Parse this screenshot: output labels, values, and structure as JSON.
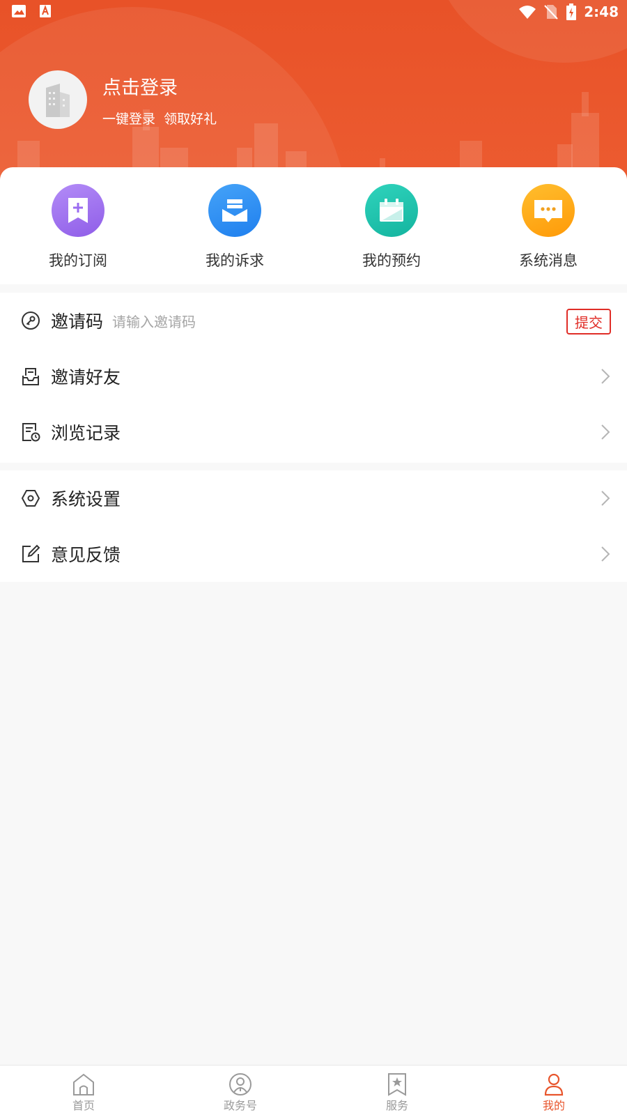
{
  "status_bar": {
    "time": "2:48"
  },
  "profile": {
    "login_title": "点击登录",
    "login_subtitle": "一键登录  领取好礼"
  },
  "quick_actions": [
    {
      "label": "我的订阅",
      "icon": "bookmark-add-icon",
      "color": "#9b6cf0"
    },
    {
      "label": "我的诉求",
      "icon": "mail-icon",
      "color": "#2b8cf4"
    },
    {
      "label": "我的预约",
      "icon": "calendar-icon",
      "color": "#1cc2ac"
    },
    {
      "label": "系统消息",
      "icon": "message-icon",
      "color": "#ffa510"
    }
  ],
  "invite_code": {
    "label": "邀请码",
    "placeholder": "请输入邀请码",
    "submit_label": "提交"
  },
  "menu_section_1": [
    {
      "label": "邀请好友",
      "icon": "inbox-icon"
    },
    {
      "label": "浏览记录",
      "icon": "history-icon"
    }
  ],
  "menu_section_2": [
    {
      "label": "系统设置",
      "icon": "settings-icon"
    },
    {
      "label": "意见反馈",
      "icon": "edit-icon"
    }
  ],
  "bottom_nav": [
    {
      "label": "首页",
      "icon": "home-icon",
      "active": false
    },
    {
      "label": "政务号",
      "icon": "government-account-icon",
      "active": false
    },
    {
      "label": "服务",
      "icon": "service-star-icon",
      "active": false
    },
    {
      "label": "我的",
      "icon": "user-icon",
      "active": true
    }
  ],
  "colors": {
    "brand": "#e85228",
    "active_tab": "#e8552c",
    "submit_border": "#e02d27"
  }
}
